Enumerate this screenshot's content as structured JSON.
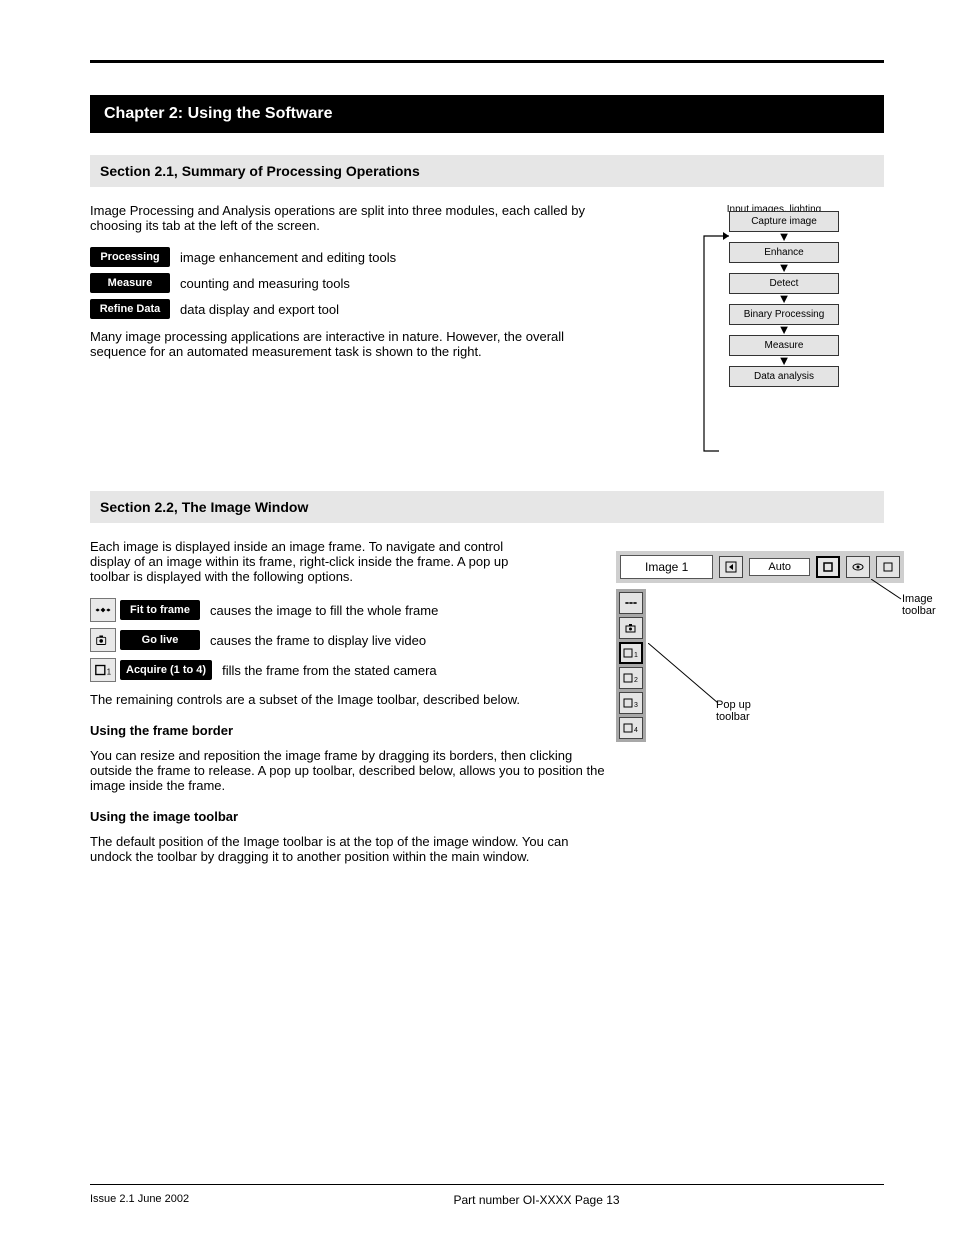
{
  "chapter_title": "Chapter 2: Using the Software",
  "section_ops": {
    "heading": "Section 2.1, Summary of Processing Operations",
    "intro": "Image Processing and Analysis operations are split into three modules, each called by choosing its tab at the left of the screen.",
    "items": [
      {
        "btn": "Processing",
        "text": "image enhancement and editing tools"
      },
      {
        "btn": "Measure",
        "text": "counting and measuring tools"
      },
      {
        "btn": "Refine Data",
        "text": "data display and export tool"
      }
    ],
    "note": "Many image processing applications are interactive in nature. However, the overall sequence for an automated measurement task is shown to the right."
  },
  "flowchart": {
    "header": "Input images, lighting",
    "boxes": [
      "Capture image",
      "Enhance",
      "Detect",
      "Binary Processing",
      "Measure",
      "Data analysis"
    ]
  },
  "section_window": {
    "heading": "Section 2.2, The Image Window",
    "intro": "Each image is displayed inside an image frame. To navigate and control display of an image within its frame, right-click inside the frame. A pop up toolbar is displayed with the following options.",
    "items": [
      {
        "label": "Fit to frame",
        "text": "causes the image to fill the whole frame"
      },
      {
        "label": "Go live",
        "text": "causes the frame to display live video"
      },
      {
        "label": "Acquire (1 to 4)",
        "text": "fills the frame from the stated camera"
      }
    ],
    "outro": "The remaining controls are a subset of the Image toolbar, described below.",
    "sub1_head": "Using the frame border",
    "sub1_text": "You can resize and reposition the image frame by dragging its borders, then clicking outside the frame to release. A pop up toolbar, described below, allows you to position the image inside the frame.",
    "sub2_head": "Using the image toolbar",
    "sub2_text": "The default position of the Image toolbar is at the top of the image window. You can undock the toolbar by dragging it to another position within the main window."
  },
  "screenshot": {
    "dropdown": "Image 1",
    "auto": "Auto",
    "side_buttons": [
      "⇔",
      "🎥",
      "▢1",
      "▢2",
      "▢3",
      "▢4"
    ],
    "callout_right": "Image toolbar",
    "callout_left": "Pop up\ntoolbar"
  },
  "footer": {
    "left": "Issue 2.1 June 2002",
    "center": "Part number OI-XXXX   Page 13"
  }
}
